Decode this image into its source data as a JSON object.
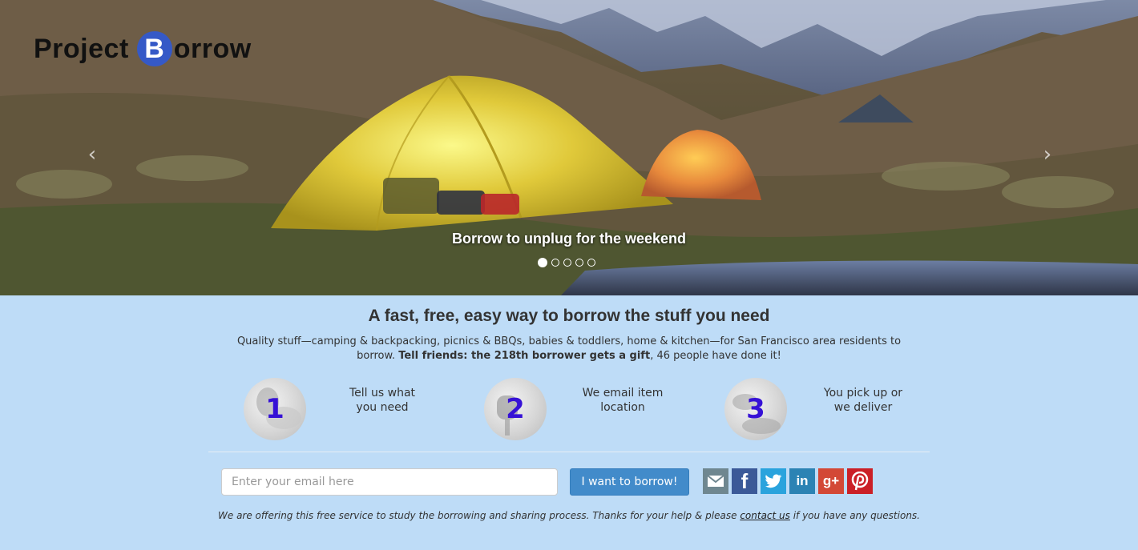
{
  "brand": {
    "logo_part1": "Project",
    "logo_b": "B",
    "logo_part2": "orrow"
  },
  "hero": {
    "caption": "Borrow to unplug for the weekend",
    "prev_icon": "chevron-left-icon",
    "next_icon": "chevron-right-icon",
    "slides_count": 5,
    "active_slide": 1
  },
  "main": {
    "headline": "A fast, free, easy way to borrow the stuff you need",
    "desc_part1": "Quality stuff—camping & backpacking, picnics & BBQs, babies & toddlers, home & kitchen—for San Francisco area residents to borrow.",
    "desc_bold": "Tell friends: the 218th borrower gets a gift",
    "desc_part2": ", 46 people have done it!"
  },
  "steps": [
    {
      "number": "1",
      "line1": "Tell us what",
      "line2": "you need"
    },
    {
      "number": "2",
      "line1": "We email item",
      "line2": "location"
    },
    {
      "number": "3",
      "line1": "You pick up or",
      "line2": "we deliver"
    }
  ],
  "signup": {
    "email_placeholder": "Enter your email here",
    "button_label": "I want to borrow!"
  },
  "social": [
    {
      "name": "email-icon",
      "color": "#6f8790"
    },
    {
      "name": "facebook-icon",
      "label": "f",
      "color": "#3b5998"
    },
    {
      "name": "twitter-icon",
      "color": "#2aa3dd"
    },
    {
      "name": "linkedin-icon",
      "label": "in",
      "color": "#2c83b4"
    },
    {
      "name": "google-plus-icon",
      "label": "g+",
      "color": "#d34836"
    },
    {
      "name": "pinterest-icon",
      "label": "P",
      "color": "#cb2027"
    }
  ],
  "footnote": {
    "before": "We are offering this free service to study the borrowing and sharing process. Thanks for your help & please ",
    "link": "contact us",
    "after": " if you have any questions."
  },
  "colors": {
    "page_bg": "#bedcf7",
    "button_blue": "#428bca",
    "step_number": "#3611d6",
    "logo_b_circle": "#3559c7"
  }
}
